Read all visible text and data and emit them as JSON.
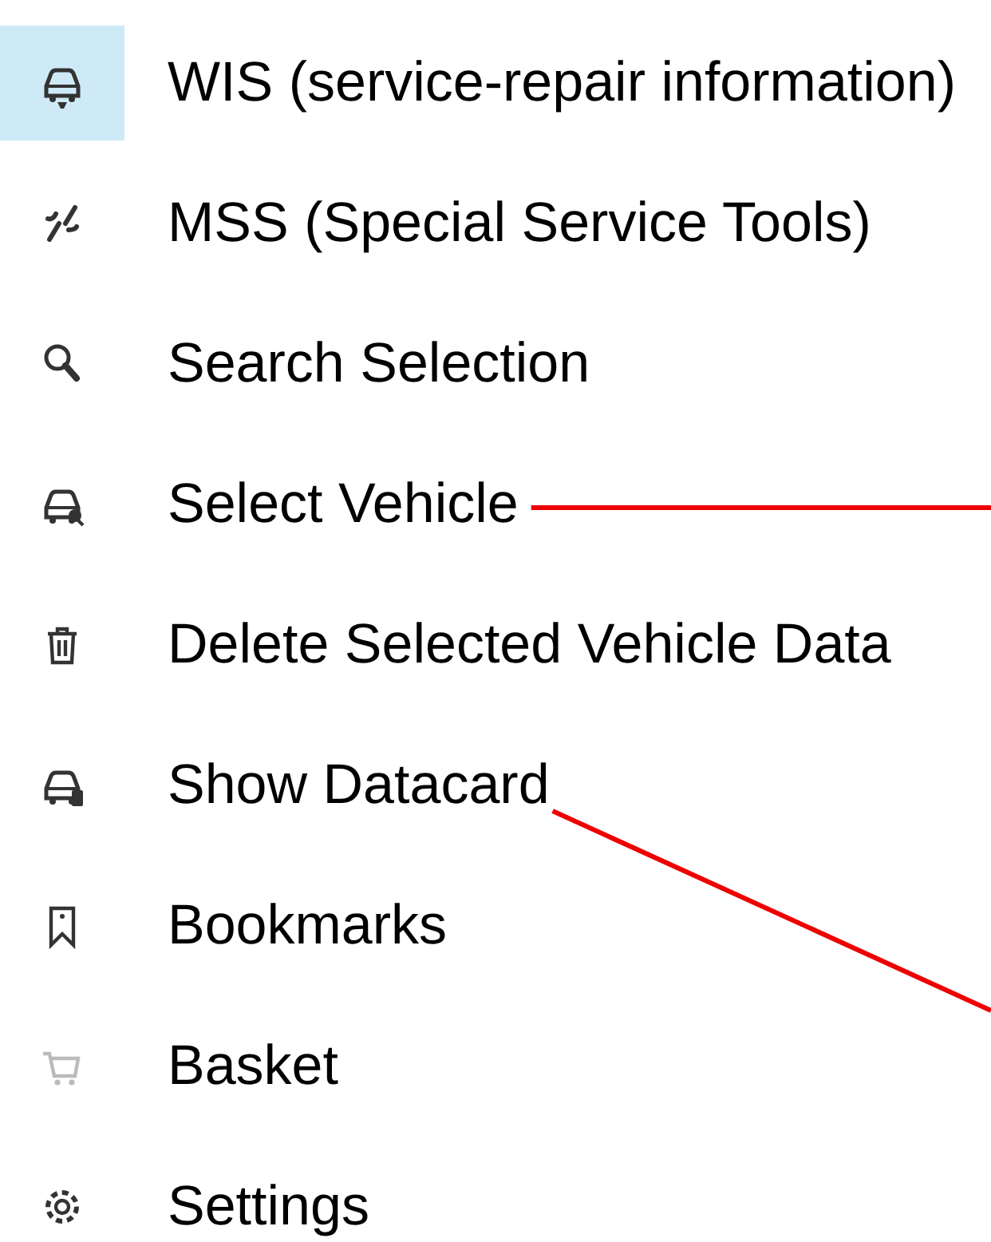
{
  "menu": {
    "items": [
      {
        "label": "WIS (service-repair information)",
        "selected": true,
        "disabled": false
      },
      {
        "label": "MSS (Special Service Tools)",
        "selected": false,
        "disabled": false
      },
      {
        "label": "Search Selection",
        "selected": false,
        "disabled": false
      },
      {
        "label": "Select Vehicle",
        "selected": false,
        "disabled": false
      },
      {
        "label": "Delete Selected Vehicle Data",
        "selected": false,
        "disabled": false
      },
      {
        "label": "Show Datacard",
        "selected": false,
        "disabled": false
      },
      {
        "label": "Bookmarks",
        "selected": false,
        "disabled": false
      },
      {
        "label": "Basket",
        "selected": false,
        "disabled": true
      },
      {
        "label": "Settings",
        "selected": false,
        "disabled": false
      }
    ]
  }
}
